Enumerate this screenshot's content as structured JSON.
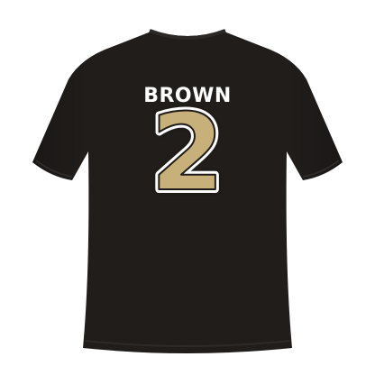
{
  "product": {
    "player_name": "BROWN",
    "jersey_number": "2",
    "shirt_color": "#201d1b",
    "number_fill": "#c7b07a",
    "number_outline_inner": "#ffffff",
    "number_outline_outer": "#1e1b19",
    "name_color": "#ffffff"
  }
}
